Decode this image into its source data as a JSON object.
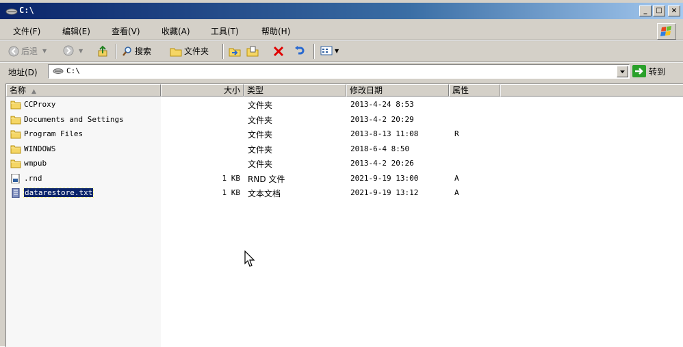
{
  "window": {
    "title": "C:\\",
    "buttons": {
      "minimize": "_",
      "maximize": "□",
      "close": "×"
    }
  },
  "menu": [
    {
      "label": "文件(F)"
    },
    {
      "label": "编辑(E)"
    },
    {
      "label": "查看(V)"
    },
    {
      "label": "收藏(A)"
    },
    {
      "label": "工具(T)"
    },
    {
      "label": "帮助(H)"
    }
  ],
  "toolbar": {
    "back_label": "后退",
    "search_label": "搜索",
    "folders_label": "文件夹"
  },
  "address": {
    "label": "地址(D)",
    "value": "C:\\",
    "go_label": "转到"
  },
  "columns": {
    "name": "名称",
    "size": "大小",
    "type": "类型",
    "modified": "修改日期",
    "attributes": "属性"
  },
  "files": [
    {
      "name": "CCProxy",
      "size": "",
      "type": "文件夹",
      "modified": "2013-4-24 8:53",
      "attr": "",
      "icon": "folder-icon"
    },
    {
      "name": "Documents and Settings",
      "size": "",
      "type": "文件夹",
      "modified": "2013-4-2 20:29",
      "attr": "",
      "icon": "folder-icon"
    },
    {
      "name": "Program Files",
      "size": "",
      "type": "文件夹",
      "modified": "2013-8-13 11:08",
      "attr": "R",
      "icon": "folder-icon"
    },
    {
      "name": "WINDOWS",
      "size": "",
      "type": "文件夹",
      "modified": "2018-6-4 8:50",
      "attr": "",
      "icon": "folder-icon"
    },
    {
      "name": "wmpub",
      "size": "",
      "type": "文件夹",
      "modified": "2013-4-2 20:26",
      "attr": "",
      "icon": "folder-icon"
    },
    {
      "name": ".rnd",
      "size": "1 KB",
      "type": "RND 文件",
      "modified": "2021-9-19 13:00",
      "attr": "A",
      "icon": "file-icon"
    },
    {
      "name": "datarestore.txt",
      "size": "1 KB",
      "type": "文本文档",
      "modified": "2021-9-19 13:12",
      "attr": "A",
      "icon": "text-file-icon"
    }
  ],
  "selected_file": "datarestore.txt",
  "colors": {
    "titlebar": "#0a246a",
    "face": "#d4d0c8",
    "selection": "#0a246a",
    "delete": "#e00000",
    "go_arrow": "#2aa02a"
  }
}
